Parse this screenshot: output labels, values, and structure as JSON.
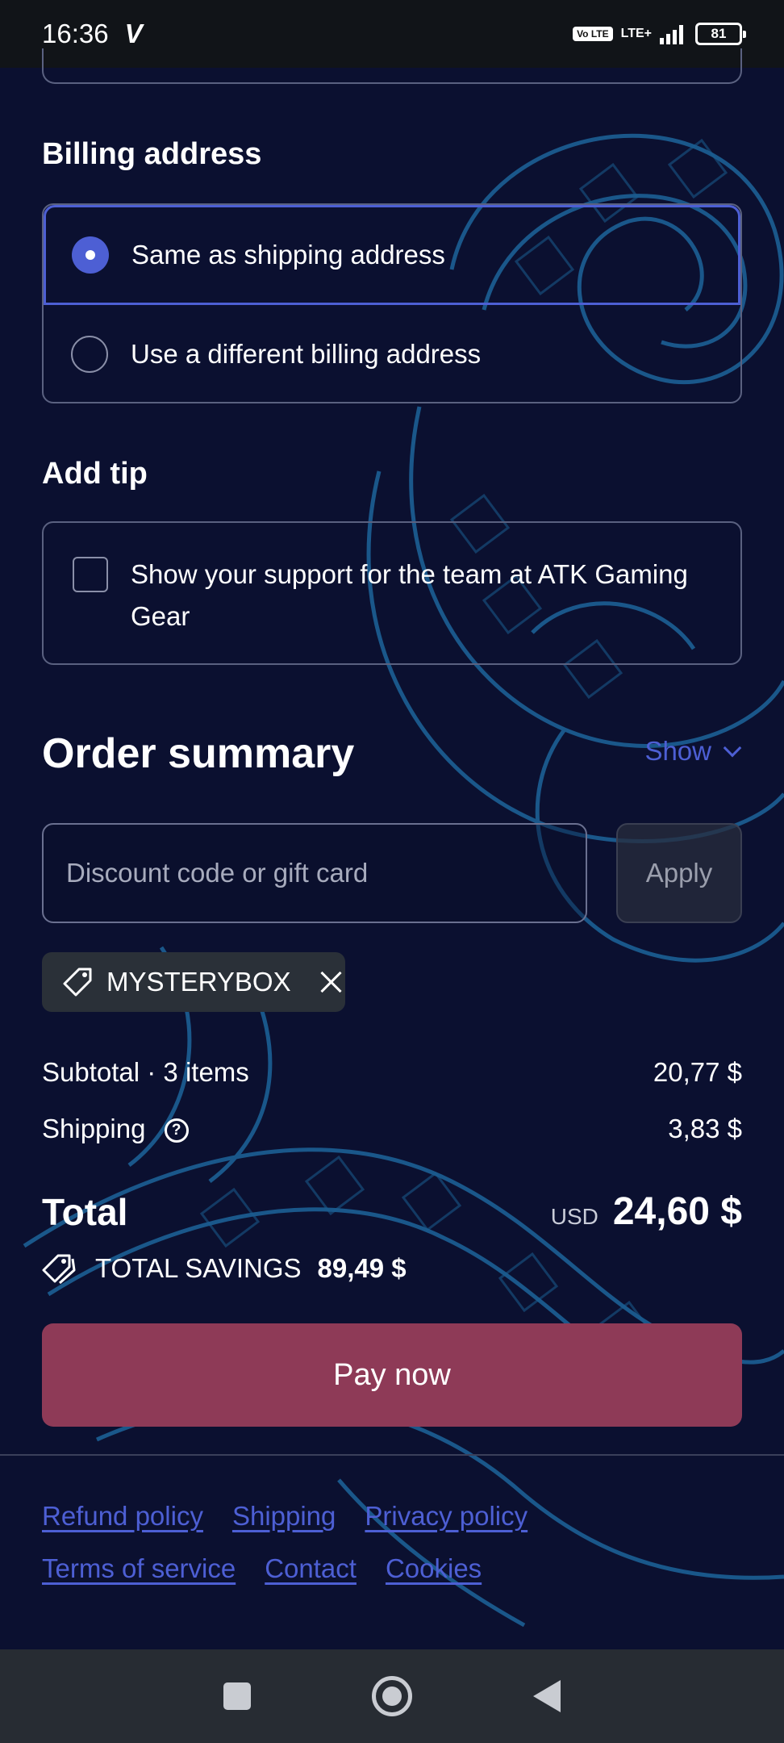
{
  "status_bar": {
    "time": "16:36",
    "carrier_icon": "V",
    "volte": "Vo LTE",
    "network": "LTE+",
    "battery": "81"
  },
  "billing": {
    "title": "Billing address",
    "options": [
      {
        "label": "Same as shipping address",
        "selected": true
      },
      {
        "label": "Use a different billing address",
        "selected": false
      }
    ]
  },
  "tip": {
    "title": "Add tip",
    "checkbox_label": "Show your support for the team at ATK Gaming Gear"
  },
  "order_summary": {
    "title": "Order summary",
    "toggle_label": "Show",
    "discount_placeholder": "Discount code or gift card",
    "apply_label": "Apply",
    "applied_code": "MYSTERYBOX",
    "subtotal_label": "Subtotal · 3 items",
    "subtotal_value": "20,77 $",
    "shipping_label": "Shipping",
    "shipping_value": "3,83 $",
    "total_label": "Total",
    "total_currency": "USD",
    "total_value": "24,60 $",
    "savings_label": "TOTAL SAVINGS",
    "savings_value": "89,49 $"
  },
  "pay_button": "Pay now",
  "footer": {
    "row1": [
      "Refund policy",
      "Shipping",
      "Privacy policy"
    ],
    "row2": [
      "Terms of service",
      "Contact",
      "Cookies"
    ]
  },
  "colors": {
    "background": "#0b1030",
    "accent": "#4d5fd4",
    "pay_button": "#8e3a57"
  }
}
